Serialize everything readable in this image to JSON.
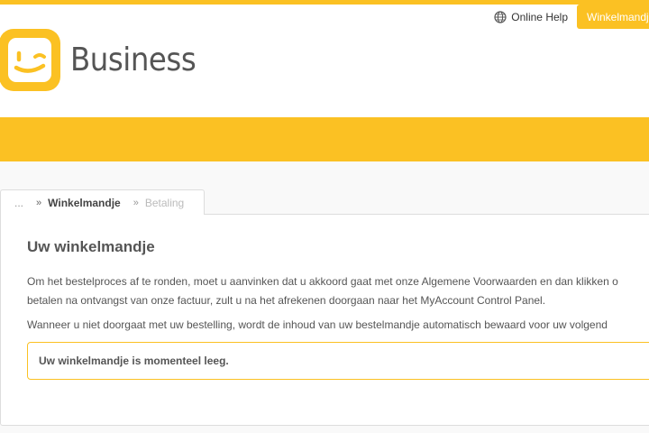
{
  "colors": {
    "accent": "#fbc123",
    "text": "#555555",
    "border": "#dddddd"
  },
  "header": {
    "online_help_label": "Online Help",
    "online_help_icon": "globe-icon",
    "cart_tab_label": "Winkelmandje",
    "logo_text": "Business",
    "logo_icon": "smiley-logo-icon"
  },
  "breadcrumb": {
    "ellipsis": "...",
    "separator": "»",
    "current": "Winkelmandje",
    "next": "Betaling"
  },
  "main": {
    "title": "Uw winkelmandje",
    "paragraph1_line1": "Om het bestelproces af te ronden, moet u aanvinken dat u akkoord gaat met onze Algemene Voorwaarden en dan klikken o",
    "paragraph1_line2": "betalen na ontvangst van onze factuur, zult u na het afrekenen doorgaan naar het MyAccount Control Panel.",
    "paragraph2": "Wanneer u niet doorgaat met uw bestelling, wordt de inhoud van uw bestelmandje automatisch bewaard voor uw volgend",
    "empty_notice": "Uw winkelmandje is momenteel leeg."
  }
}
